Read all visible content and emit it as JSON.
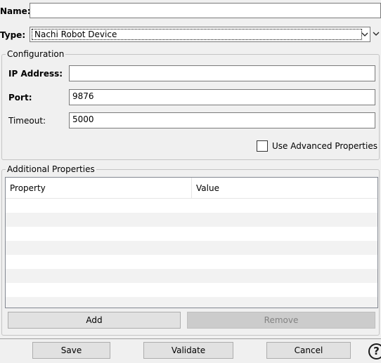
{
  "form": {
    "name_label": "Name:",
    "name_value": "",
    "type_label": "Type:",
    "type_value": "Nachi Robot Device"
  },
  "configuration": {
    "legend": "Configuration",
    "ip_label": "IP Address:",
    "ip_value": "",
    "port_label": "Port:",
    "port_value": "9876",
    "timeout_label": "Timeout:",
    "timeout_value": "5000",
    "advanced_label": "Use Advanced Properties",
    "advanced_checked": false
  },
  "additional": {
    "legend": "Additional Properties",
    "columns": [
      "Property",
      "Value"
    ],
    "rows": [],
    "add_label": "Add",
    "remove_label": "Remove"
  },
  "footer": {
    "save_label": "Save",
    "validate_label": "Validate",
    "cancel_label": "Cancel",
    "help_label": "?"
  },
  "icons": {
    "dropdown": "chevron-down-icon",
    "help": "help-icon"
  },
  "colors": {
    "window_bg": "#f0f0f0",
    "zebra_row": "#f2f2f2",
    "disabled_button": "#cccccc"
  }
}
